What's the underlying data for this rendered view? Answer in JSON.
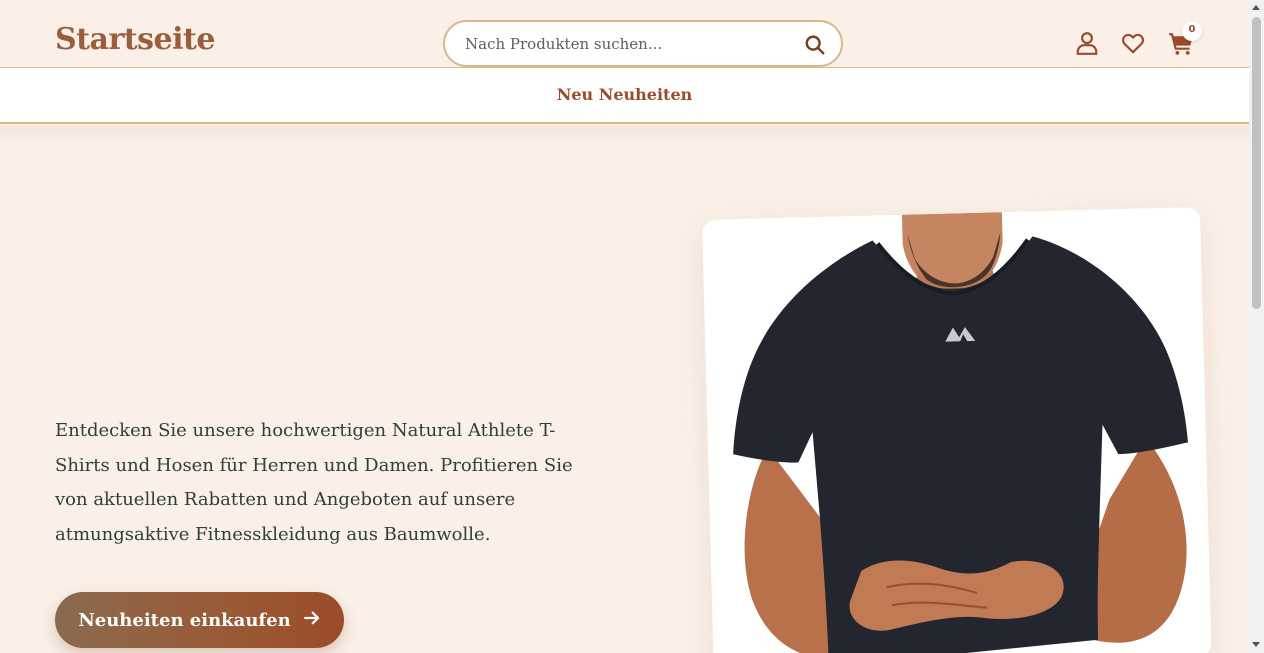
{
  "header": {
    "logo": "Startseite",
    "search_placeholder": "Nach Produkten suchen...",
    "cart_count": "0"
  },
  "nav": {
    "link": "Neu Neuheiten"
  },
  "hero": {
    "description": "Entdecken Sie unsere hochwertigen Natural Athlete T-Shirts und Hosen für Herren und Damen. Profitieren Sie von aktuellen Rabatten und Angeboten auf unsere atmungsaktive Fitnesskleidung aus Baumwolle.",
    "cta_label": "Neuheiten einkaufen"
  },
  "icons": {
    "search": "search-icon",
    "account": "user-icon",
    "wishlist": "heart-icon",
    "cart": "cart-icon",
    "cta_arrow": "arrow-right-icon"
  },
  "colors": {
    "background": "#faf0e7",
    "accent": "#9b4a2c",
    "logo": "#9b5e3c",
    "border": "#d9b98a",
    "text": "#2f3e3a"
  }
}
